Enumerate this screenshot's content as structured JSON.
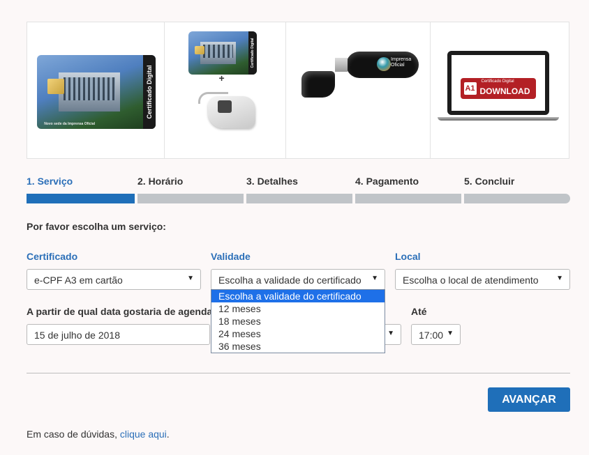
{
  "products": [
    {
      "name": "card",
      "card_title": "Certificado Digital",
      "card_footer": "Novo sede da Imprensa Oficial"
    },
    {
      "name": "card-reader",
      "card_title": "Certificado Digital",
      "plus": "+"
    },
    {
      "name": "usb-token",
      "token_label": "Imprensa Oficial"
    },
    {
      "name": "download",
      "top_text": "Certificado Digital",
      "badge": "A1",
      "word": "DOWNLOAD"
    }
  ],
  "steps": [
    {
      "label": "1. Serviço",
      "active": true
    },
    {
      "label": "2. Horário",
      "active": false
    },
    {
      "label": "3. Detalhes",
      "active": false
    },
    {
      "label": "4. Pagamento",
      "active": false
    },
    {
      "label": "5. Concluir",
      "active": false
    }
  ],
  "prompt": "Por favor escolha um serviço:",
  "fields": {
    "certificado": {
      "label": "Certificado",
      "value": "e-CPF A3 em cartão"
    },
    "validade": {
      "label": "Validade",
      "value": "Escolha a validade do certificado"
    },
    "local": {
      "label": "Local",
      "value": "Escolha o local de atendimento"
    },
    "data": {
      "label": "A partir de qual data gostaria de agendar?",
      "value": "15 de julho de 2018"
    },
    "ate": {
      "label": "Até",
      "value": "17:00"
    }
  },
  "dropdown": {
    "options": [
      "Escolha a validade do certificado",
      "12 meses",
      "18 meses",
      "24 meses",
      "36 meses"
    ],
    "selected_index": 0
  },
  "button": {
    "label": "AVANÇAR"
  },
  "help": {
    "text": "Em caso de dúvidas, ",
    "link": "clique aqui",
    "suffix": "."
  },
  "colors": {
    "primary": "#1f6fb9",
    "label_blue": "#2b6fb8",
    "inactive_bar": "#c0c4c8",
    "highlight": "#1e70e8",
    "download_red": "#b32025"
  }
}
